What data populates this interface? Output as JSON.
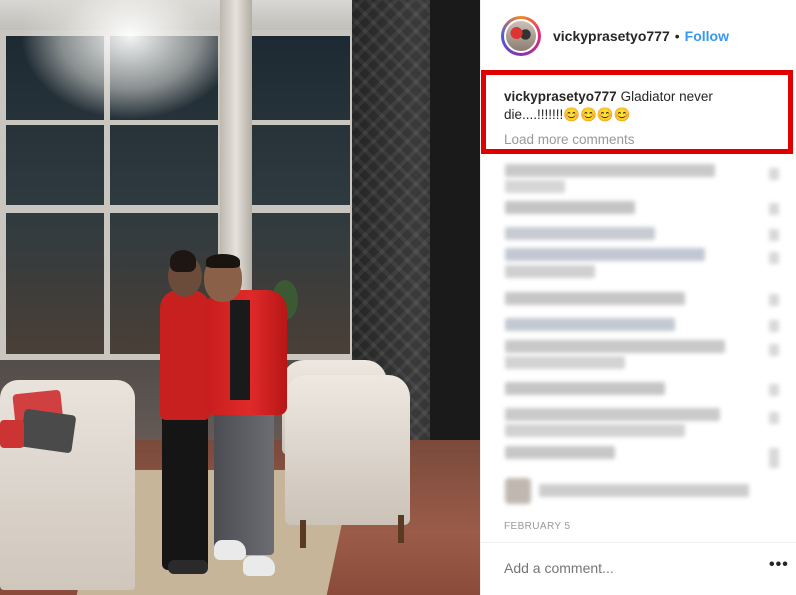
{
  "post": {
    "username": "vickyprasetyo777",
    "separator": "•",
    "follow_label": "Follow",
    "caption_user": "vickyprasetyo777",
    "caption_text": "Gladiator never die....!!!!!!!😊😊😊😊",
    "load_more": "Load more comments",
    "date": "FEBRUARY 5",
    "comment_placeholder": "Add a comment...",
    "more_icon": "•••"
  },
  "icons": {
    "avatar": "profile-avatar",
    "more": "more-options-icon"
  },
  "colors": {
    "link": "#3897f0",
    "highlight": "#e00000",
    "muted": "#999999"
  }
}
